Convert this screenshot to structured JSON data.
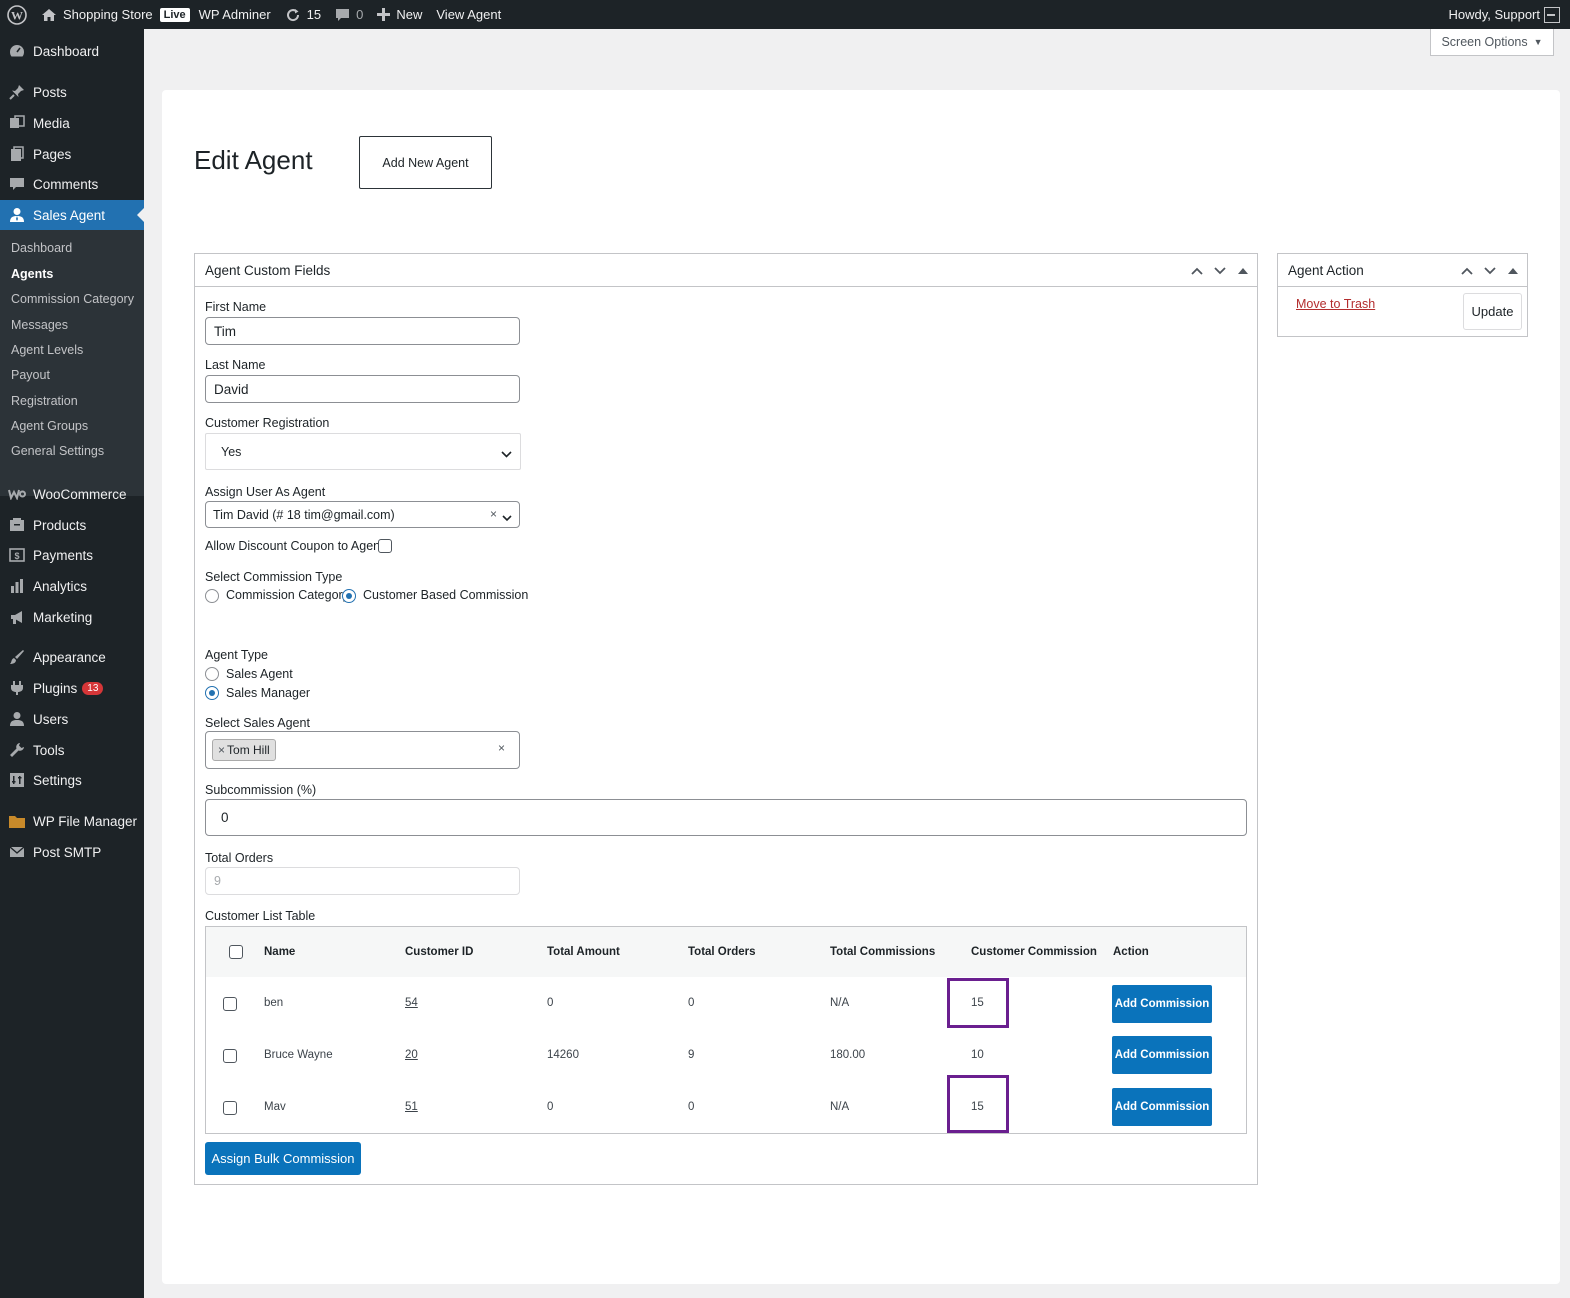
{
  "adminbar": {
    "site_name": "Shopping Store",
    "live_badge": "Live",
    "wp_adminer": "WP Adminer",
    "updates_count": "15",
    "comments_count": "0",
    "new_label": "New",
    "view_agent": "View Agent",
    "howdy": "Howdy, Support"
  },
  "sidebar": {
    "menu": [
      {
        "label": "Dashboard",
        "icon": "dashboard-icon"
      },
      {
        "label": "Posts",
        "icon": "pin-icon"
      },
      {
        "label": "Media",
        "icon": "media-icon"
      },
      {
        "label": "Pages",
        "icon": "pages-icon"
      },
      {
        "label": "Comments",
        "icon": "comment-icon"
      },
      {
        "label": "Sales Agent",
        "icon": "user-tie-icon"
      },
      {
        "label": "WooCommerce",
        "icon": "woo-icon"
      },
      {
        "label": "Products",
        "icon": "products-icon"
      },
      {
        "label": "Payments",
        "icon": "payments-icon"
      },
      {
        "label": "Analytics",
        "icon": "bar-chart-icon"
      },
      {
        "label": "Marketing",
        "icon": "megaphone-icon"
      },
      {
        "label": "Appearance",
        "icon": "brush-icon"
      },
      {
        "label": "Plugins",
        "icon": "plugin-icon"
      },
      {
        "label": "Users",
        "icon": "users-icon"
      },
      {
        "label": "Tools",
        "icon": "wrench-icon"
      },
      {
        "label": "Settings",
        "icon": "settings-icon"
      },
      {
        "label": "WP File Manager",
        "icon": "folder-icon"
      },
      {
        "label": "Post SMTP",
        "icon": "mail-icon"
      }
    ],
    "plugins_badge": "13",
    "submenu": [
      "Dashboard",
      "Agents",
      "Commission Category",
      "Messages",
      "Agent Levels",
      "Payout",
      "Registration",
      "Agent Groups",
      "General Settings"
    ]
  },
  "screen_options": "Screen Options",
  "page": {
    "title": "Edit Agent",
    "add_new_button": "Add New Agent"
  },
  "custom_fields": {
    "header": "Agent Custom Fields",
    "first_name_label": "First Name",
    "first_name_value": "Tim",
    "last_name_label": "Last Name",
    "last_name_value": "David",
    "customer_registration_label": "Customer Registration",
    "customer_registration_value": "Yes",
    "assign_user_label": "Assign User As Agent",
    "assign_user_value": "Tim David (# 18 tim@gmail.com)",
    "allow_discount_label": "Allow Discount Coupon to Agent",
    "commission_type_label": "Select Commission Type",
    "commission_type_options": [
      "Commission Category",
      "Customer Based Commission"
    ],
    "commission_type_selected": "Customer Based Commission",
    "agent_type_label": "Agent Type",
    "agent_type_options": [
      "Sales Agent",
      "Sales Manager"
    ],
    "agent_type_selected": "Sales Manager",
    "select_sales_agent_label": "Select Sales Agent",
    "selected_sales_agent": "Tom Hill",
    "subcommission_label": "Subcommission (%)",
    "subcommission_value": "0",
    "total_orders_label": "Total Orders",
    "total_orders_placeholder": "9",
    "customer_list_label": "Customer List Table",
    "bulk_button": "Assign Bulk Commission"
  },
  "customer_table": {
    "columns": [
      "Name",
      "Customer ID",
      "Total Amount",
      "Total Orders",
      "Total Commissions",
      "Customer Commission",
      "Action"
    ],
    "rows": [
      {
        "name": "ben",
        "customer_id": "54",
        "total_amount": "0",
        "total_orders": "0",
        "total_commissions": "N/A",
        "customer_commission": "15",
        "action": "Add Commission"
      },
      {
        "name": "Bruce Wayne",
        "customer_id": "20",
        "total_amount": "14260",
        "total_orders": "9",
        "total_commissions": "180.00",
        "customer_commission": "10",
        "action": "Add Commission"
      },
      {
        "name": "Mav",
        "customer_id": "51",
        "total_amount": "0",
        "total_orders": "0",
        "total_commissions": "N/A",
        "customer_commission": "15",
        "action": "Add Commission"
      }
    ]
  },
  "agent_action": {
    "header": "Agent Action",
    "trash_link": "Move to Trash",
    "update_button": "Update"
  },
  "colors": {
    "admin_dark": "#1d2327",
    "primary_blue": "#2271b1",
    "button_blue": "#0a73bb",
    "highlight_purple": "#6a1f8f",
    "trash_red": "#b32d2e"
  }
}
